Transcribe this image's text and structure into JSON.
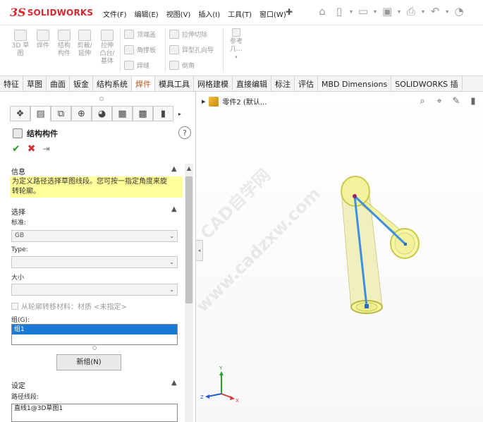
{
  "app": {
    "ds_mark": "3S",
    "brand": "SOLIDWORKS"
  },
  "menu": [
    "文件(F)",
    "编辑(E)",
    "视图(V)",
    "插入(I)",
    "工具(T)",
    "窗口(W)"
  ],
  "ribbon": {
    "btn1": "3D 草\n图",
    "btn2": "焊件",
    "btn3": "结构\n构件",
    "btn4": "剪裁/\n延伸",
    "btn5": "拉伸\n凸台/\n基体",
    "small1": "顶端盖",
    "small2": "角撑板",
    "small3": "焊缝",
    "small4": "拉伸切除",
    "small5": "异型孔向导",
    "small6": "倒角",
    "ref": "参考\n几..."
  },
  "tabs": [
    "特征",
    "草图",
    "曲面",
    "钣金",
    "结构系统",
    "焊件",
    "模具工具",
    "网格建模",
    "直接编辑",
    "标注",
    "评估",
    "MBD Dimensions",
    "SOLIDWORKS 插"
  ],
  "active_tab": "焊件",
  "panel": {
    "title": "结构构件",
    "help": "?",
    "info_title": "信息",
    "info_text_1": "为定义路径选择草图线段。您可按一指定角度来旋",
    "info_text_2": "转轮廓。",
    "select_title": "选择",
    "standard_label": "标准:",
    "standard_value": "GB",
    "type_label": "Type:",
    "size_label": "大小",
    "material_chk": "从轮廓转移材料：材质 <未指定>",
    "group_label": "组(G):",
    "group_item": "组1",
    "new_group": "新组(N)",
    "settings_title": "设定",
    "path_label": "路径线段:",
    "path_value": "直线1@3D草图1"
  },
  "graphics": {
    "tree_label": "零件2 (默认...",
    "triad": {
      "x": "X",
      "y": "Y",
      "z": "Z"
    }
  },
  "watermarks": [
    "CAD自学网",
    "www.cadzxw.com"
  ],
  "colors": {
    "tube_fill": "#f3f39a",
    "tube_edge": "#c9c94a",
    "path_line": "#3d8fe0",
    "selection": "#1a78d6",
    "info_bg": "#ffff99"
  }
}
